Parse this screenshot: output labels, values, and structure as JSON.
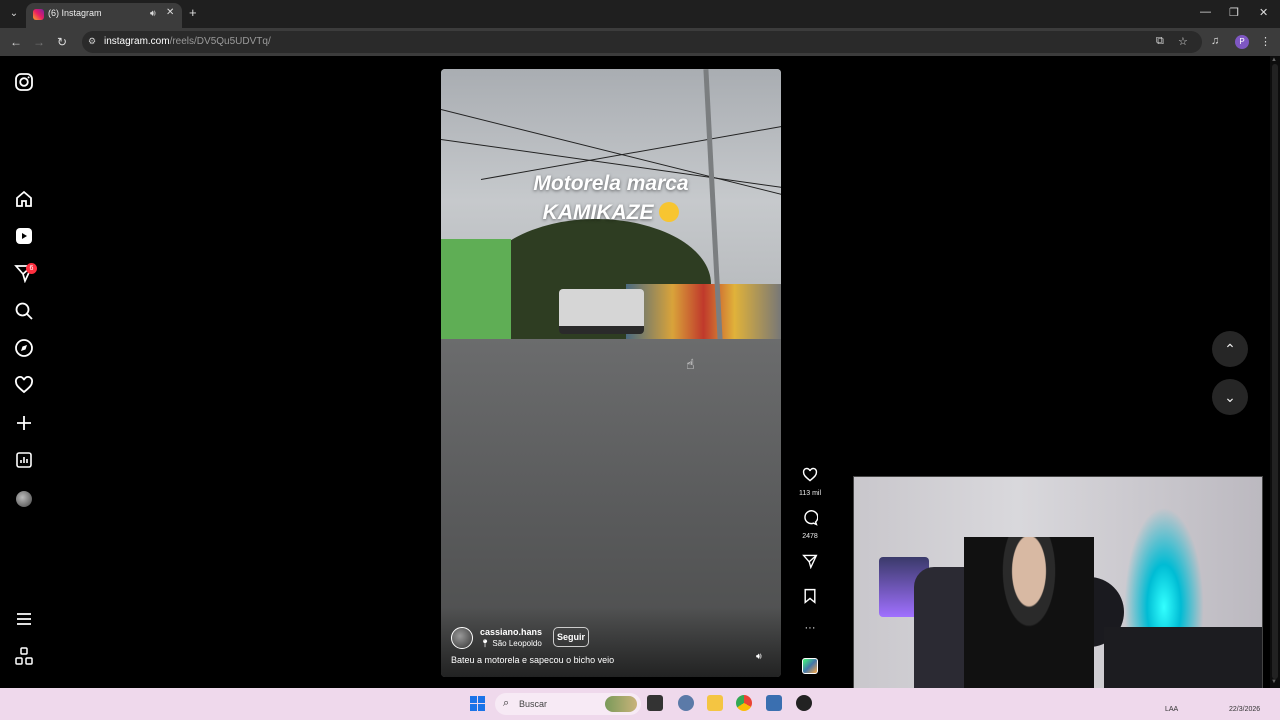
{
  "browser": {
    "tab_title": "(6) Instagram",
    "tab_audio_icon": "speaker-icon",
    "tab_close": "✕",
    "new_tab": "+",
    "url_host": "instagram.com",
    "url_path": "/reels/DV5Qu5UDVTq/",
    "profile_initial": "P",
    "window_controls": [
      "—",
      "❐",
      "✕"
    ]
  },
  "sidebar": {
    "items": [
      "instagram-logo-icon",
      "home-icon",
      "reels-icon",
      "messages-icon",
      "search-icon",
      "explore-icon",
      "notifications-icon",
      "create-icon",
      "dashboard-icon",
      "profile-avatar",
      "menu-icon",
      "also-from-meta-icon"
    ],
    "notification_count": "6"
  },
  "reel": {
    "caption_line1": "Motorela marca",
    "caption_line2": "KAMIKAZE",
    "author": "cassiano.hans",
    "location": "São Leopoldo",
    "follow_label": "Seguir",
    "description": "Bateu a motorela e sapecou o bicho veio",
    "likes": "113 mil",
    "comments": "2478",
    "more": "···"
  },
  "nav": {
    "up": "⌃",
    "down": "⌄"
  },
  "taskbar": {
    "search_placeholder": "Buscar",
    "tray_lang": "LAA",
    "tray_date": "22/3/2026"
  },
  "colors": {
    "accent": "#ff3040",
    "taskbar": "#efd9ec",
    "chrome_bar": "#3c3c3c"
  }
}
